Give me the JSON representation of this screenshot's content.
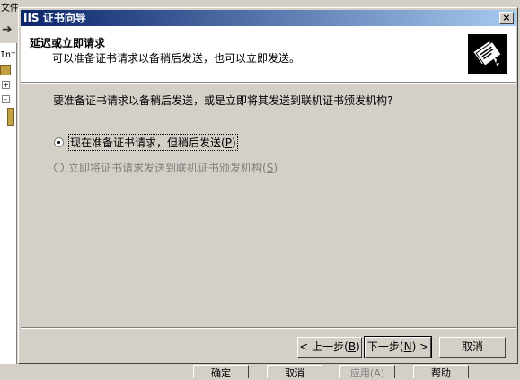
{
  "background": {
    "menu_label": "文件",
    "tree_label": "Int",
    "bottom_buttons": [
      "确定",
      "取消",
      "应用(A)",
      "帮助"
    ]
  },
  "dialog": {
    "title": "IIS 证书向导",
    "close_glyph": "×",
    "header": {
      "title": "延迟或立即请求",
      "subtitle": "可以准备证书请求以备稍后发送，也可以立即发送。",
      "icon": "certificate-icon"
    },
    "question": "要准备证书请求以备稍后发送，或是立即将其发送到联机证书颁发机构?",
    "options": [
      {
        "label": "现在准备证书请求，但稍后发送",
        "accel_prefix": "(",
        "accel_key": "P",
        "accel_suffix": ")",
        "checked": true,
        "enabled": true
      },
      {
        "label": "立即将证书请求发送到联机证书颁发机构",
        "accel_prefix": "(",
        "accel_key": "S",
        "accel_suffix": ")",
        "checked": false,
        "enabled": false
      }
    ],
    "buttons": {
      "back": {
        "label": "< 上一步",
        "accel_prefix": "(",
        "accel_key": "B",
        "accel_suffix": ")"
      },
      "next": {
        "label": "下一步",
        "accel_prefix": "(",
        "accel_key": "N",
        "accel_suffix": ") >"
      },
      "cancel": {
        "label": "取消"
      }
    }
  },
  "colors": {
    "title_start": "#0a246a",
    "title_end": "#a6caf0",
    "face": "#d4d0c8"
  }
}
